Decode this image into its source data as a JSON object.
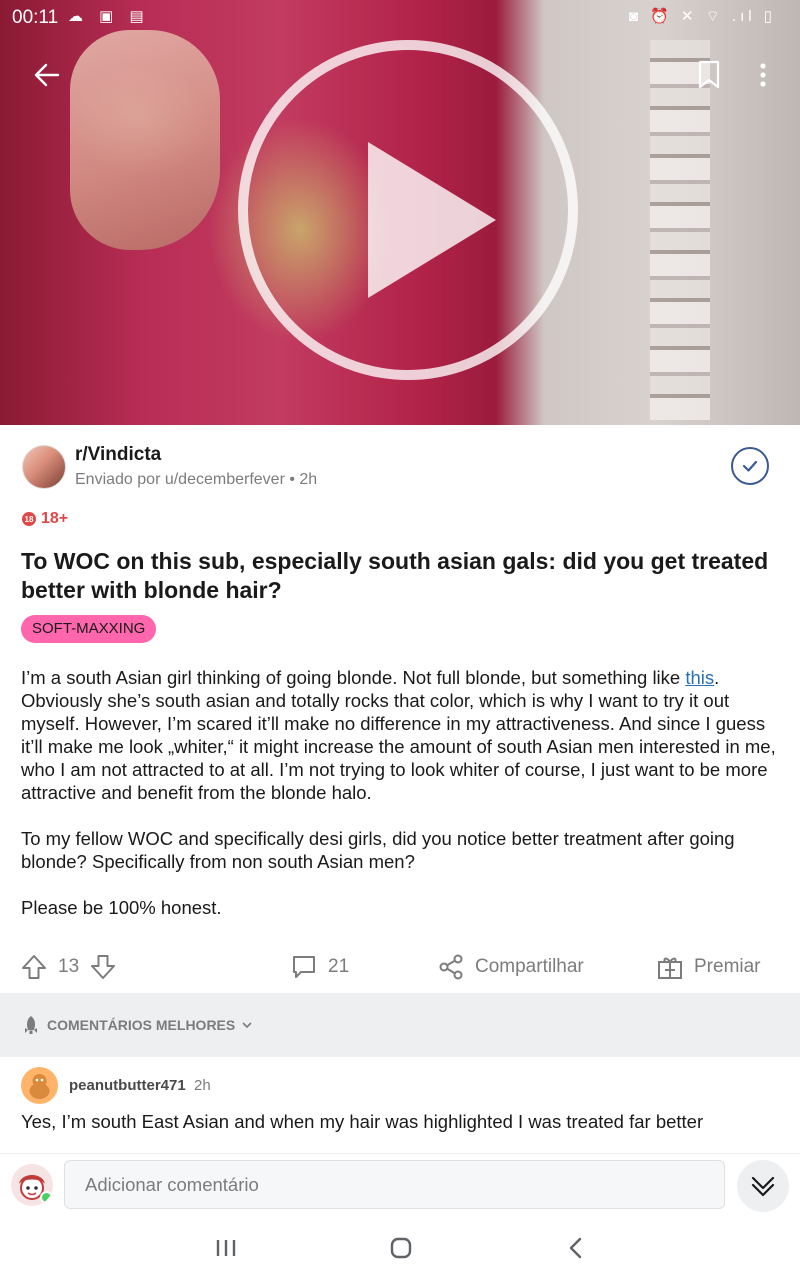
{
  "status_bar": {
    "time": "00:11",
    "left_icons": "☁ ▣ ▤",
    "right_icons": "◙ ⏰ ✕ ⌔ .ıl ▯"
  },
  "media": {
    "play_icon": "play-icon",
    "back_icon": "arrow-left-icon",
    "bookmark_icon": "bookmark-icon",
    "more_icon": "more-vertical-icon"
  },
  "post": {
    "subreddit": "r/Vindicta",
    "posted_by": "Enviado por u/decemberfever • 2h",
    "nsfw_badge_icon": "18",
    "nsfw_label": "18+",
    "title": "To WOC on this sub, especially south asian gals: did you get treated better with blonde hair?",
    "flair": "SOFT-MAXXING",
    "body": {
      "p1_before_link": "I’m a south Asian girl thinking of going blonde. Not full blonde, but something like ",
      "p1_link": "this",
      "p1_after_link": ". Obviously she’s south asian and totally rocks that color, which is why I want to try it out myself. However, I’m scared it’ll make no difference in my attractiveness. And since I guess it’ll make me look „whiter,“ it might increase the amount of south Asian men interested in me, who I am not attracted to at all. I’m not trying to look whiter of course, I just want to be more attractive and benefit from the blonde halo.",
      "p2": "To my fellow WOC and specifically desi girls, did you notice better treatment after going blonde? Specifically from non south Asian men?",
      "p3": "Please be 100% honest."
    }
  },
  "actions": {
    "votes": "13",
    "comments": "21",
    "share": "Compartilhar",
    "award": "Premiar"
  },
  "sort": {
    "label": "COMENTÁRIOS MELHORES"
  },
  "comment": {
    "author": "peanutbutter471",
    "time": "2h",
    "text": "Yes, I’m south East Asian and when my hair was highlighted I was treated far better"
  },
  "composer": {
    "placeholder": "Adicionar comentário"
  }
}
